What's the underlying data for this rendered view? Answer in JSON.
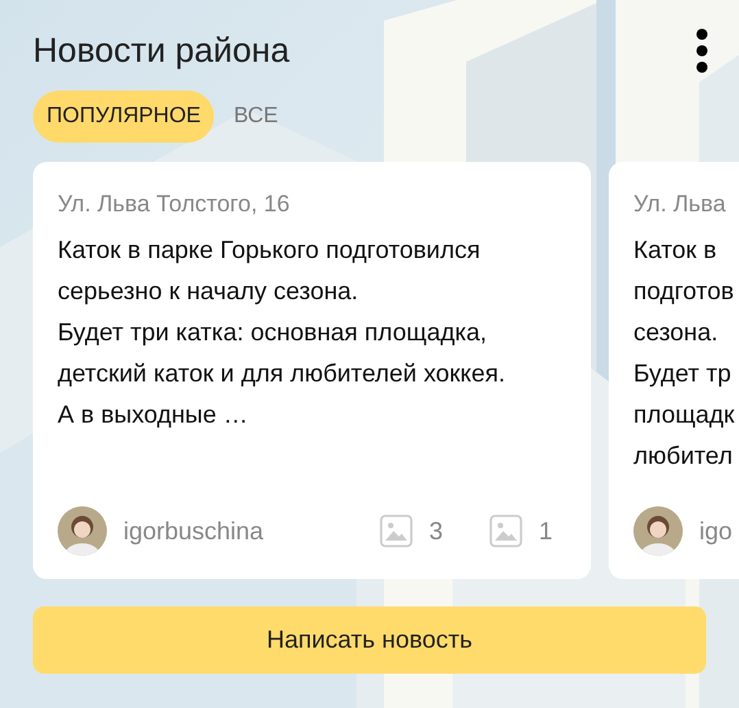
{
  "header": {
    "title": "Новости района"
  },
  "tabs": [
    {
      "label": "ПОПУЛЯРНОЕ",
      "selected": true
    },
    {
      "label": "ВСЕ",
      "selected": false
    }
  ],
  "cards": [
    {
      "kind": "full",
      "address": "Ул. Льва Толстого, 16",
      "text": "Каток в парке Горького подготовился серьезно к началу сезона.\nБудет три катка: основная площадка, детский каток и для любителей хоккея. А в выходные …",
      "author": "igorbuschina",
      "stats": [
        "3",
        "1"
      ]
    },
    {
      "kind": "cut",
      "address": "Ул. Льва",
      "lines": [
        "Каток в",
        "подготов",
        "сезона.",
        "Будет тр",
        "площадк",
        "любител"
      ],
      "author": "igo"
    }
  ],
  "button": {
    "label": "Написать новость"
  }
}
